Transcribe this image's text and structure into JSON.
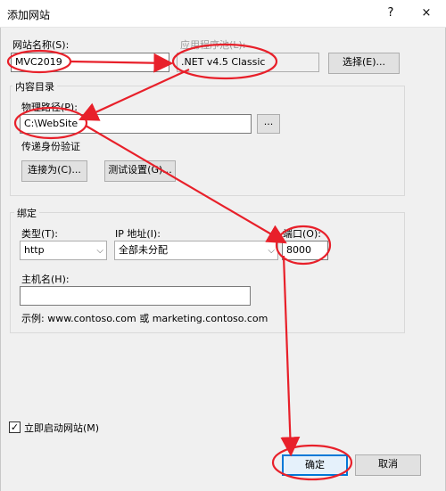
{
  "window": {
    "title": "添加网站",
    "help_glyph": "?",
    "close_glyph": "×"
  },
  "site": {
    "name_label": "网站名称(S):",
    "name_value": "MVC2019",
    "app_pool_label": "应用程序池(L):",
    "app_pool_value": ".NET v4.5 Classic",
    "select_button": "选择(E)..."
  },
  "content_dir": {
    "group_label": "内容目录",
    "path_label": "物理路径(P):",
    "path_value": "C:\\WebSite",
    "browse_button": "...",
    "auth_label": "传递身份验证",
    "connect_as_button": "连接为(C)...",
    "test_settings_button": "测试设置(G)..."
  },
  "binding": {
    "group_label": "绑定",
    "type_label": "类型(T):",
    "type_value": "http",
    "ip_label": "IP 地址(I):",
    "ip_value": "全部未分配",
    "port_label": "端口(O):",
    "port_value": "8000",
    "host_label": "主机名(H):",
    "host_value": "",
    "example_text": "示例: www.contoso.com 或 marketing.contoso.com"
  },
  "start_site": {
    "label": "立即启动网站(M)",
    "checked": true,
    "check_glyph": "✓"
  },
  "footer": {
    "ok_button": "确定",
    "cancel_button": "取消"
  },
  "icons": {
    "dropdown": "chevron-down-icon"
  },
  "colors": {
    "annotation": "#e8202a",
    "default_button_border": "#0078d7"
  }
}
